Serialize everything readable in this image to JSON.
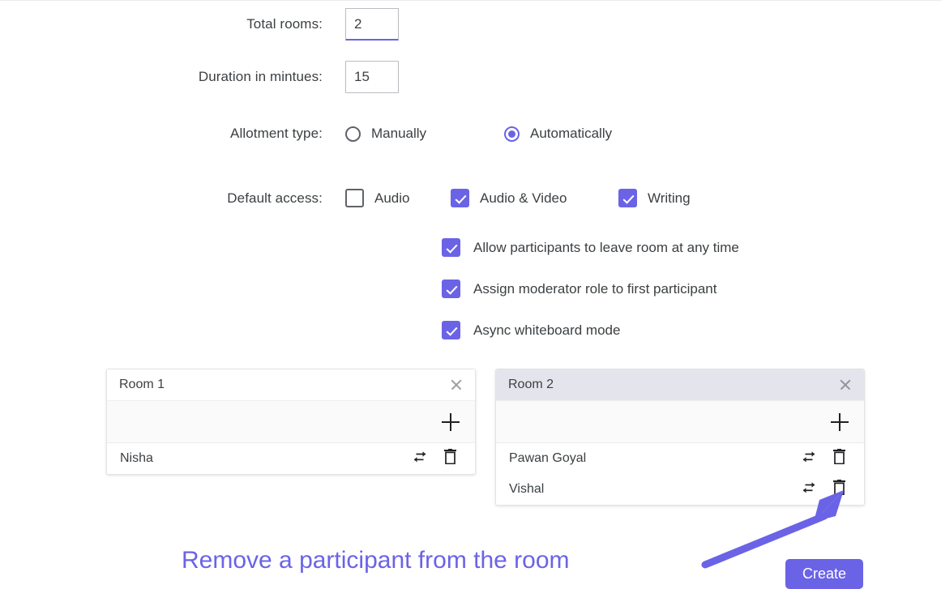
{
  "form": {
    "total_rooms": {
      "label": "Total rooms:",
      "value": "2"
    },
    "duration": {
      "label": "Duration in mintues:",
      "value": "15"
    },
    "allotment": {
      "label": "Allotment type:",
      "options": [
        {
          "label": "Manually",
          "selected": false
        },
        {
          "label": "Automatically",
          "selected": true
        }
      ]
    },
    "default_access": {
      "label": "Default access:",
      "options": [
        {
          "label": "Audio",
          "checked": false
        },
        {
          "label": "Audio & Video",
          "checked": true
        },
        {
          "label": "Writing",
          "checked": true
        }
      ]
    },
    "toggles": [
      {
        "label": "Allow participants to leave room at any time",
        "checked": true
      },
      {
        "label": "Assign moderator role to first participant",
        "checked": true
      },
      {
        "label": "Async whiteboard mode",
        "checked": true
      }
    ]
  },
  "rooms": [
    {
      "title": "Room 1",
      "header_style": "white",
      "participants": [
        "Nisha"
      ]
    },
    {
      "title": "Room 2",
      "header_style": "grey",
      "participants": [
        "Pawan Goyal",
        "Vishal"
      ]
    }
  ],
  "annotation": {
    "text": "Remove a participant from the room"
  },
  "footer": {
    "create_label": "Create"
  },
  "colors": {
    "accent": "#6b63e6",
    "text": "#3c4043",
    "card_header_grey": "#e4e5ec"
  }
}
